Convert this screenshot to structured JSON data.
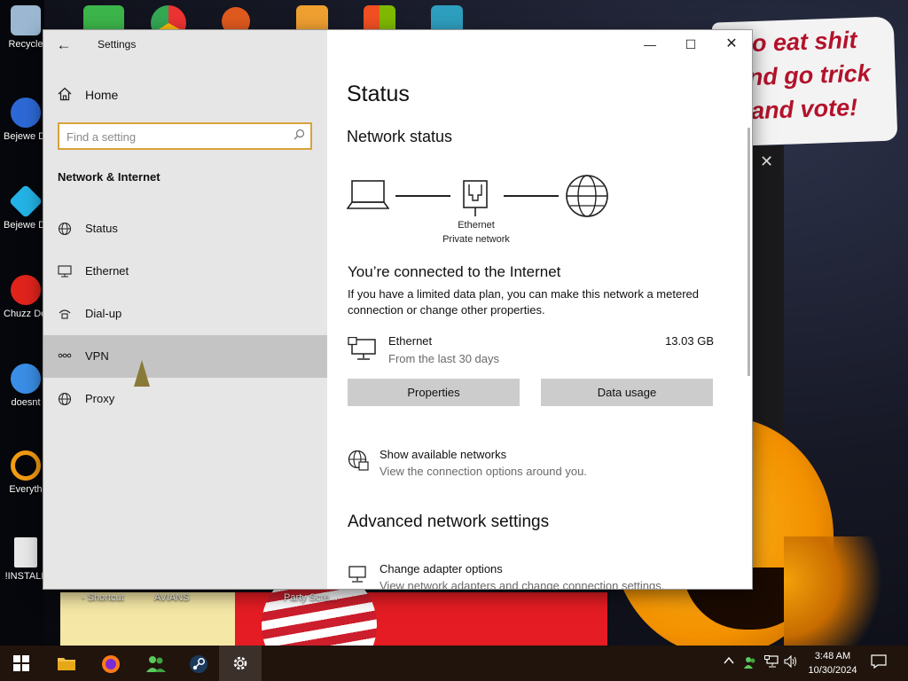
{
  "desktop": {
    "sign_lines": [
      "o eat shit",
      "nd go trick",
      "and vote!"
    ],
    "icons": [
      {
        "label": "Recycle",
        "icon": "recycle-bin-icon",
        "color": "#9bb7d1"
      },
      {
        "label": "Bejewe Delux",
        "icon": "bejeweled-icon",
        "color": "#2d69d6"
      },
      {
        "label": "Bejewe Delux",
        "icon": "bejeweled-2-icon",
        "color": "#23b3e6"
      },
      {
        "label": "Chuzz Delux",
        "icon": "chuzzle-icon",
        "color": "#e0241c"
      },
      {
        "label": "doesnt",
        "icon": "app-icon",
        "color": "#3a8ee6"
      },
      {
        "label": "Everyth",
        "icon": "everything-search-icon",
        "color": "#f29c12"
      },
      {
        "label": "!INSTALL",
        "icon": "text-file-icon",
        "color": "#e8e8e8"
      }
    ],
    "bottom_labels": [
      "- Shortcut",
      "AVIANS",
      "Party Scre..."
    ]
  },
  "window": {
    "title": "Settings",
    "back_label": "←",
    "controls": {
      "minimize": "—",
      "maximize": "☐",
      "close": "✕"
    }
  },
  "sidebar": {
    "home_label": "Home",
    "search_placeholder": "Find a setting",
    "section_title": "Network & Internet",
    "items": [
      {
        "label": "Status",
        "icon": "status-globe-icon",
        "selected": false
      },
      {
        "label": "Ethernet",
        "icon": "ethernet-icon",
        "selected": false
      },
      {
        "label": "Dial-up",
        "icon": "dial-up-icon",
        "selected": false
      },
      {
        "label": "VPN",
        "icon": "vpn-icon",
        "selected": true
      },
      {
        "label": "Proxy",
        "icon": "proxy-globe-icon",
        "selected": false
      }
    ]
  },
  "main": {
    "title": "Status",
    "network_status_heading": "Network status",
    "diagram": {
      "adapter_name": "Ethernet",
      "network_type": "Private network"
    },
    "connected_heading": "You’re connected to the Internet",
    "connected_desc": "If you have a limited data plan, you can make this network a metered connection or change other properties.",
    "connection": {
      "name": "Ethernet",
      "period": "From the last 30 days",
      "usage": "13.03 GB"
    },
    "buttons": {
      "properties": "Properties",
      "data_usage": "Data usage"
    },
    "show_networks": {
      "title": "Show available networks",
      "subtitle": "View the connection options around you."
    },
    "advanced_heading": "Advanced network settings",
    "adapter_options": {
      "title": "Change adapter options",
      "subtitle": "View network adapters and change connection settings."
    }
  },
  "taskbar": {
    "apps": [
      "start-icon",
      "file-explorer-icon",
      "firefox-icon",
      "people-icon",
      "steam-icon",
      "settings-gear-icon"
    ],
    "active_app": "settings-gear-icon",
    "time": "3:48 AM",
    "date": "10/30/2024"
  },
  "colors": {
    "accent": "#d6a33a",
    "selected_nav": "#c4c4c4",
    "sidebar_bg": "#e6e6e6",
    "taskbar_bg": "#20140c"
  }
}
